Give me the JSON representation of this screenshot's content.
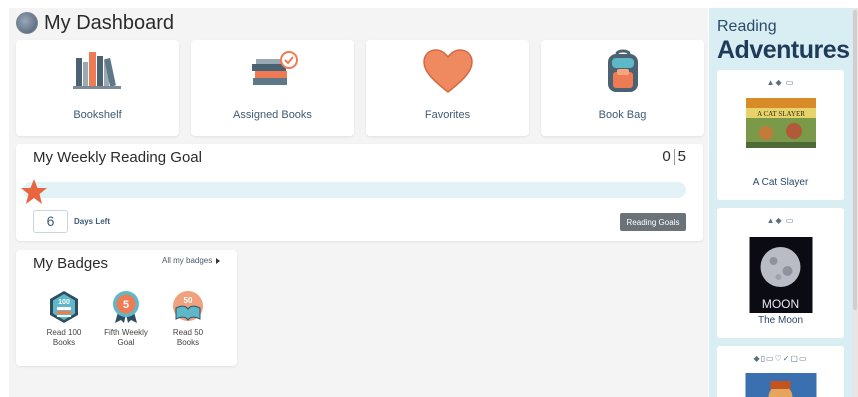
{
  "header": {
    "title": "My Dashboard",
    "avatar_icon": "user-avatar-icon"
  },
  "tiles": [
    {
      "label": "Bookshelf",
      "icon": "bookshelf-icon"
    },
    {
      "label": "Assigned Books",
      "icon": "assigned-books-icon"
    },
    {
      "label": "Favorites",
      "icon": "heart-icon"
    },
    {
      "label": "Book Bag",
      "icon": "backpack-icon"
    }
  ],
  "goal": {
    "title": "My Weekly Reading Goal",
    "completed": "0",
    "target": "5",
    "progress_fraction": 0,
    "days_left_value": "6",
    "days_left_label": "Days Left",
    "button_label": "Reading Goals"
  },
  "badges": {
    "title": "My Badges",
    "all_link": "All my badges",
    "items": [
      {
        "label": "Read 100 Books",
        "icon": "badge-100-books-icon",
        "number": "100"
      },
      {
        "label": "Fifth Weekly Goal",
        "icon": "badge-fifth-weekly-goal-icon",
        "number": "5"
      },
      {
        "label": "Read 50 Books",
        "icon": "badge-50-books-icon",
        "number": "50"
      }
    ]
  },
  "reading_adventures": {
    "title_line1": "Reading",
    "title_line2": "Adventures",
    "books": [
      {
        "title": "A Cat Slayer",
        "cover_text": "A CAT SLAYER"
      },
      {
        "title": "The Moon",
        "cover_text": "MOON"
      },
      {
        "title": ""
      }
    ]
  },
  "colors": {
    "accent": "#ef7b55",
    "progress_track": "#e2f2f6",
    "panel_bg": "#d9eef3",
    "heading": "#1f3b5a",
    "label": "#3e5b73",
    "button": "#6b7379"
  }
}
